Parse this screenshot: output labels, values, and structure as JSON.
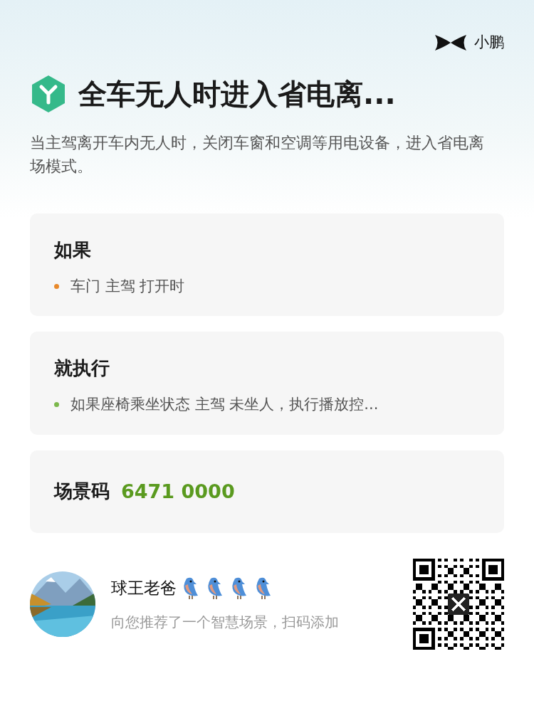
{
  "brand": {
    "name": "小鹏"
  },
  "title": "全车无人时进入省电离...",
  "description": "当主驾离开车内无人时，关闭车窗和空调等用电设备，进入省电离场模式。",
  "sections": [
    {
      "heading": "如果",
      "items": [
        {
          "text": "车门 主驾 打开时",
          "color": "#e8892b"
        }
      ]
    },
    {
      "heading": "就执行",
      "items": [
        {
          "text": "如果座椅乘坐状态 主驾 未坐人，执行播放控...",
          "color": "#7cb84c"
        }
      ]
    }
  ],
  "scene_code": {
    "label": "场景码",
    "value": "6471 0000"
  },
  "sharer": {
    "name": "球王老爸",
    "badges": [
      {
        "kind": "bird"
      },
      {
        "kind": "bird"
      },
      {
        "kind": "bird"
      },
      {
        "kind": "bird"
      }
    ],
    "message": "向您推荐了一个智慧场景，扫码添加"
  }
}
